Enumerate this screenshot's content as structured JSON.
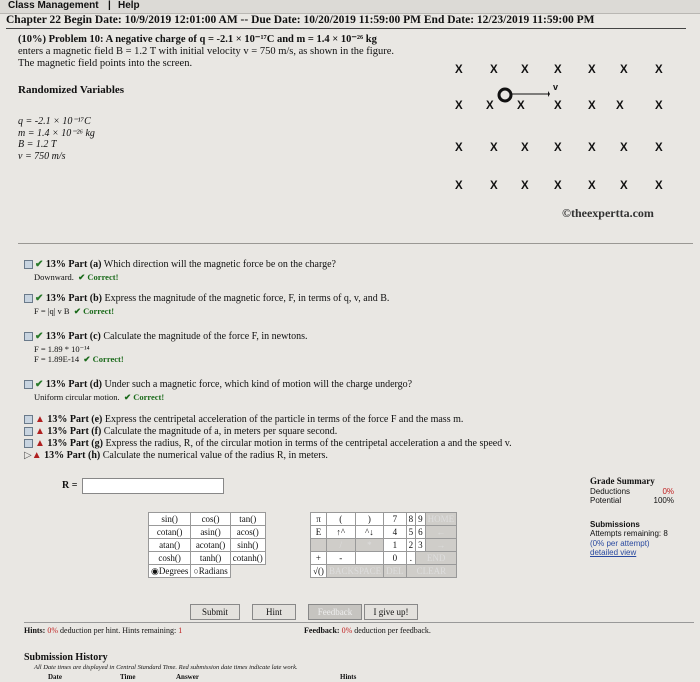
{
  "topbar": {
    "menu1": "Class Management",
    "menu2": "Help",
    "sep": "|"
  },
  "header": {
    "text": "Chapter 22 Begin Date: 10/9/2019 12:01:00 AM -- Due Date: 10/20/2019 11:59:00 PM End Date: 12/23/2019 11:59:00 PM"
  },
  "problem": {
    "line1": "(10%) Problem 10:  A negative charge of q = -2.1 × 10⁻¹⁷C and m = 1.4 × 10⁻²⁶ kg",
    "line2": "enters a magnetic field B = 1.2 T with initial velocity v = 750 m/s, as shown in the figure.",
    "line3": "The magnetic field points into the screen."
  },
  "variables": {
    "title": "Randomized Variables",
    "q": "q = -2.1 × 10⁻¹⁷C",
    "m": "m = 1.4 × 10⁻²⁶ kg",
    "B": "B = 1.2 T",
    "v": "v = 750 m/s"
  },
  "figure": {
    "x": "X",
    "v_label": "v"
  },
  "credit": "©theexpertta.com",
  "parts": {
    "a": {
      "pct": "13% Part (a)",
      "q": "Which direction will the magnetic force be on the charge?",
      "ans": "Downward.",
      "status": "Correct!"
    },
    "b": {
      "pct": "13% Part (b)",
      "q": "Express the magnitude of the magnetic force, F, in terms of q, v, and B.",
      "ans": "F = |q| v B",
      "status": "Correct!"
    },
    "c": {
      "pct": "13% Part (c)",
      "q": "Calculate the magnitude of the force F, in newtons.",
      "ans1": "F = 1.89 * 10⁻¹⁴",
      "ans2": "F = 1.89E-14",
      "status": "Correct!"
    },
    "d": {
      "pct": "13% Part (d)",
      "q": "Under such a magnetic force, which kind of motion will the charge undergo?",
      "ans": "Uniform circular motion.",
      "status": "Correct!"
    },
    "e": {
      "pct": "13% Part (e)",
      "q": "Express the centripetal acceleration of the particle in terms of the force F and the mass m."
    },
    "f": {
      "pct": "13% Part (f)",
      "q": "Calculate the magnitude of a, in meters per square second."
    },
    "g": {
      "pct": "13% Part (g)",
      "q": "Express the radius, R, of the circular motion in terms of the centripetal acceleration a and the speed v."
    },
    "h": {
      "pct": "13% Part (h)",
      "q": "Calculate the numerical value of the radius R, in meters."
    }
  },
  "answer": {
    "label": "R =",
    "value": ""
  },
  "grade": {
    "title": "Grade Summary",
    "deductions_label": "Deductions",
    "deductions_val": "0%",
    "potential_label": "Potential",
    "potential_val": "100%"
  },
  "submissions": {
    "title": "Submissions",
    "line1": "Attempts remaining: 8",
    "line2": "(0% per attempt)",
    "link": "detailed view"
  },
  "calc": {
    "row1": [
      "sin()",
      "cos()",
      "tan()",
      "π",
      "(",
      ")",
      "7",
      "8",
      "9",
      "HOME"
    ],
    "row2": [
      "cotan()",
      "asin()",
      "acos()",
      "E",
      "↑^",
      "^↓",
      "4",
      "5",
      "6",
      "←"
    ],
    "row3": [
      "atan()",
      "acotan()",
      "sinh()",
      "",
      "/",
      "*",
      "1",
      "2",
      "3",
      "→"
    ],
    "row4": [
      "cosh()",
      "tanh()",
      "cotanh()",
      "+",
      "-",
      "",
      "0",
      ".",
      "END"
    ],
    "row5": [
      "Degrees",
      "Radians",
      "√()",
      "BACKSPACE",
      "DEL",
      "CLEAR"
    ]
  },
  "buttons": {
    "submit": "Submit",
    "hint": "Hint",
    "feedback": "Feedback",
    "giveup": "I give up!"
  },
  "hints": {
    "label": "Hints:",
    "pct": "0%",
    "text": "deduction per hint. Hints remaining:",
    "count": "1"
  },
  "feedback": {
    "label": "Feedback:",
    "pct": "0%",
    "text": "deduction per feedback."
  },
  "history": {
    "title": "Submission History",
    "note": "All Date times are displayed in Central Standard Time. Red submission date times indicate late work.",
    "col_date": "Date",
    "col_time": "Time",
    "col_answer": "Answer",
    "col_hints": "Hints"
  }
}
